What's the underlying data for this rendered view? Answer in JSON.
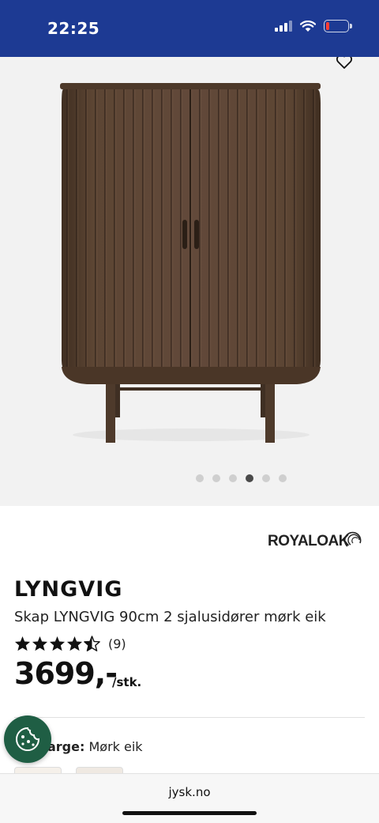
{
  "status_bar": {
    "time": "22:25",
    "background": "#1d3a93",
    "battery_level": 0.15
  },
  "gallery": {
    "image_alt": "Skap LYNGVIG",
    "dot_count": 6,
    "active_index": 3,
    "wishlist_icon": "heart-outline-icon"
  },
  "brand": {
    "name": "ROYALOAK"
  },
  "product": {
    "name": "LYNGVIG",
    "description": "Skap LYNGVIG 90cm 2 sjalusidører mørk eik",
    "rating": 4.5,
    "rating_max": 5,
    "rating_count": "(9)",
    "price": "3699,-",
    "unit": "/stk."
  },
  "color": {
    "label": "Farge:",
    "value": "Mørk eik"
  },
  "browser": {
    "url": "jysk.no"
  },
  "colors": {
    "wood": "#5a4331",
    "cookie_button": "#1f5e44"
  }
}
